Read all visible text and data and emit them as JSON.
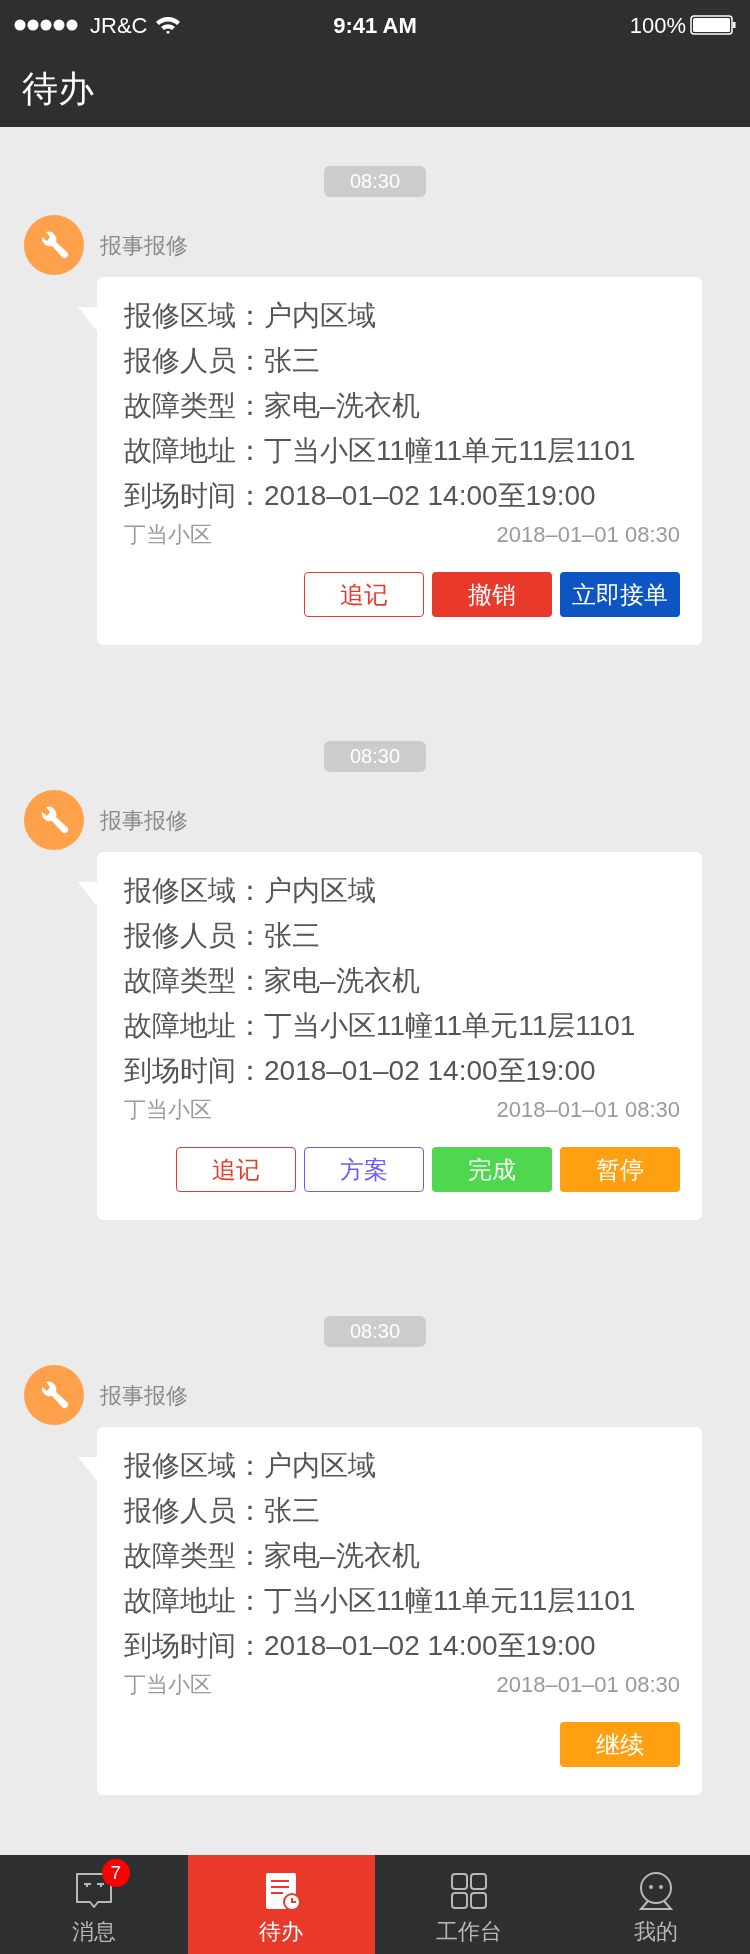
{
  "status_bar": {
    "carrier": "JR&C",
    "time": "9:41 AM",
    "battery": "100%"
  },
  "header": {
    "title": "待办"
  },
  "tasks": [
    {
      "time": "08:30",
      "category": "报事报修",
      "fields": [
        {
          "label": "报修区域：",
          "value": "户内区域"
        },
        {
          "label": "报修人员：",
          "value": "张三"
        },
        {
          "label": "故障类型：",
          "value": "家电–洗衣机"
        },
        {
          "label": "故障地址：",
          "value": "丁当小区11幢11单元11层1101"
        },
        {
          "label": "到场时间：",
          "value": "2018–01–02 14:00至19:00"
        }
      ],
      "community": "丁当小区",
      "created": "2018–01–01 08:30",
      "buttons": [
        {
          "label": "追记",
          "kind": "outline",
          "color": "#e8392a"
        },
        {
          "label": "撤销",
          "kind": "filled",
          "color": "#e8392a"
        },
        {
          "label": "立即接单",
          "kind": "filled",
          "color": "#0c55c3"
        }
      ]
    },
    {
      "time": "08:30",
      "category": "报事报修",
      "fields": [
        {
          "label": "报修区域：",
          "value": "户内区域"
        },
        {
          "label": "报修人员：",
          "value": "张三"
        },
        {
          "label": "故障类型：",
          "value": "家电–洗衣机"
        },
        {
          "label": "故障地址：",
          "value": "丁当小区11幢11单元11层1101"
        },
        {
          "label": "到场时间：",
          "value": "2018–01–02 14:00至19:00"
        }
      ],
      "community": "丁当小区",
      "created": "2018–01–01 08:30",
      "buttons": [
        {
          "label": "追记",
          "kind": "outline",
          "color": "#e8392a"
        },
        {
          "label": "方案",
          "kind": "outline",
          "color": "#6a5cff"
        },
        {
          "label": "完成",
          "kind": "filled",
          "color": "#4fd74f"
        },
        {
          "label": "暂停",
          "kind": "filled",
          "color": "#ff9f12"
        }
      ]
    },
    {
      "time": "08:30",
      "category": "报事报修",
      "fields": [
        {
          "label": "报修区域：",
          "value": "户内区域"
        },
        {
          "label": "报修人员：",
          "value": "张三"
        },
        {
          "label": "故障类型：",
          "value": "家电–洗衣机"
        },
        {
          "label": "故障地址：",
          "value": "丁当小区11幢11单元11层1101"
        },
        {
          "label": "到场时间：",
          "value": "2018–01–02 14:00至19:00"
        }
      ],
      "community": "丁当小区",
      "created": "2018–01–01 08:30",
      "buttons": [
        {
          "label": "继续",
          "kind": "filled",
          "color": "#ff9f12"
        }
      ]
    }
  ],
  "tab_bar": [
    {
      "label": "消息",
      "selected": false,
      "badge": "7"
    },
    {
      "label": "待办",
      "selected": true
    },
    {
      "label": "工作台",
      "selected": false
    },
    {
      "label": "我的",
      "selected": false
    }
  ]
}
